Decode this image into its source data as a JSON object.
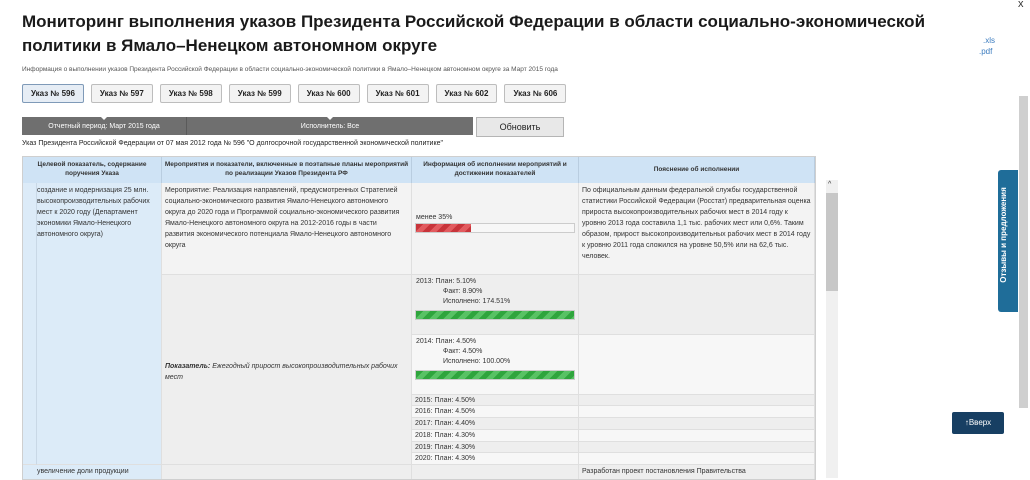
{
  "header": {
    "title": "Мониторинг выполнения указов Президента Российской Федерации в области социально-экономической политики в Ямало–Ненецком автономном округе",
    "subtitle": "Информация о выполнении указов Президента Российской Федерации в области социально-экономической политики в Ямало–Ненецком автономном округе за Март 2015 года",
    "export_xls": ".xls",
    "export_pdf": ".pdf",
    "close": "x"
  },
  "tabs": [
    {
      "label": "Указ № 596"
    },
    {
      "label": "Указ № 597"
    },
    {
      "label": "Указ № 598"
    },
    {
      "label": "Указ № 599"
    },
    {
      "label": "Указ № 600"
    },
    {
      "label": "Указ № 601"
    },
    {
      "label": "Указ № 602"
    },
    {
      "label": "Указ № 606"
    }
  ],
  "filters": {
    "period": "Отчетный период: Март 2015 года",
    "executor": "Исполнитель: Все",
    "refresh": "Обновить"
  },
  "decree_title": "Указ Президента Российской Федерации от 07 мая 2012 года № 596 \"О долгосрочной государственной экономической политике\"",
  "table": {
    "headers": [
      "Целевой показатель, содержание поручения Указа",
      "Мероприятия и показатели, включенные в поэтапные планы мероприятий по реализации Указов Президента РФ",
      "Информация об исполнении мероприятий и достижении показателей",
      "Пояснение об исполнении"
    ],
    "row1": {
      "goal": "создание и модернизация 25 млн. высокопроизводительных рабочих мест к 2020 году (Департамент экономики Ямало-Ненецкого автономного округа)",
      "measure": "Мероприятие: Реализация направлений, предусмотренных Стратегией социально-экономического развития Ямало-Ненецкого автономного округа до 2020 года и Программой социально-экономического развития Ямало-Ненецкого автономного округа на 2012-2016 годы в части развития экономического потенциала Ямало-Ненецкого автономного округа",
      "status_label": "менее 35%",
      "status_fraction": 0.35,
      "explanation": "По официальным данным федеральной службы государственной статистики Российской Федерации (Росстат) предварительная оценка прироста высокопроизводительных рабочих мест в 2014 году к уровню 2013 года составила 1,1 тыс. рабочих мест или 0,6%. Таким образом, прирост высокопроизводительных рабочих мест в 2014 году к уровню 2011 года сложился на уровне 50,5% или на 62,6 тыс. человек."
    },
    "indicator": {
      "label_prefix": "Показатель:",
      "label_text": "Ежегодный прирост высокопроизводительных рабочих мест"
    },
    "years": [
      {
        "plan": "2013: План: 5.10%",
        "fact": "Факт: 8.90%",
        "done": "Исполнено: 174.51%",
        "fill": 1.0
      },
      {
        "plan": "2014: План: 4.50%",
        "fact": "Факт: 4.50%",
        "done": "Исполнено: 100.00%",
        "fill": 1.0
      }
    ],
    "future_plans": [
      "2015: План: 4.50%",
      "2016: План: 4.50%",
      "2017: План: 4.40%",
      "2018: План: 4.30%",
      "2019: План: 4.30%",
      "2020: План: 4.30%"
    ],
    "row2": {
      "goal": "увеличение доли продукции",
      "explanation": "Разработан проект постановления Правительства"
    }
  },
  "scroll_up_glyph": "^",
  "feedback_label": "Отзывы и предложения",
  "to_top": "↑Вверх",
  "colors": {
    "bar_red": "#c8343a",
    "bar_green": "#2fa53d",
    "header_blue": "#cfe3f5",
    "feedback": "#1f6d99",
    "to_top": "#173f63"
  }
}
